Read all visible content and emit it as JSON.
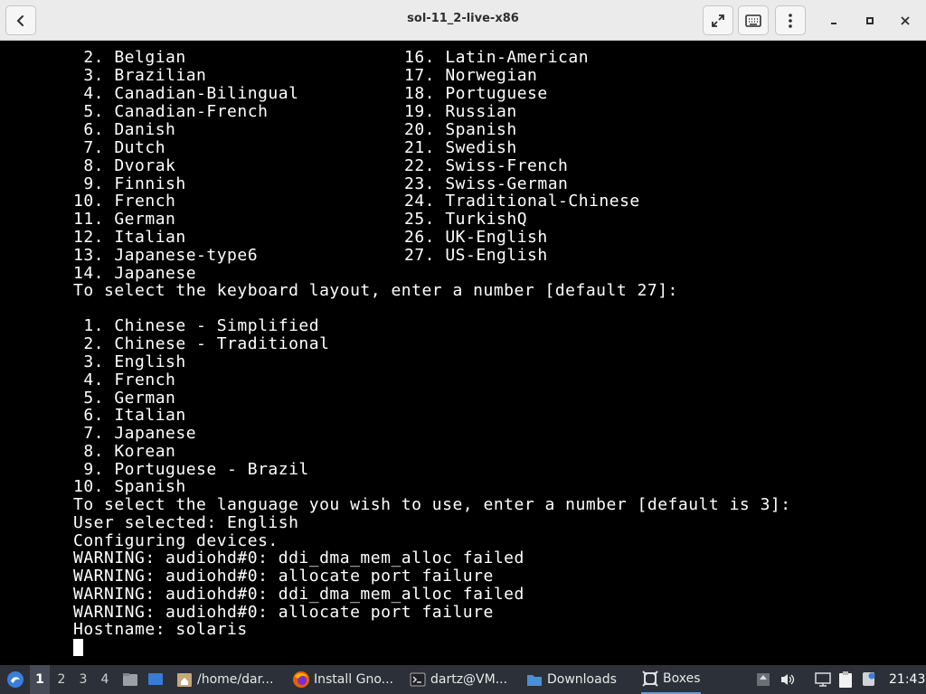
{
  "window": {
    "title": "sol-11_2-live-x86"
  },
  "console": {
    "lines": [
      " 2. Belgian",
      " 3. Brazilian",
      " 4. Canadian-Bilingual",
      " 5. Canadian-French",
      " 6. Danish",
      " 7. Dutch",
      " 8. Dvorak",
      " 9. Finnish",
      "10. French",
      "11. German",
      "12. Italian",
      "13. Japanese-type6",
      "14. Japanese"
    ],
    "lines_right": [
      "16. Latin-American",
      "17. Norwegian",
      "18. Portuguese",
      "19. Russian",
      "20. Spanish",
      "21. Swedish",
      "22. Swiss-French",
      "23. Swiss-German",
      "24. Traditional-Chinese",
      "25. TurkishQ",
      "26. UK-English",
      "27. US-English"
    ],
    "keyboard_prompt": "To select the keyboard layout, enter a number [default 27]:",
    "languages": [
      " 1. Chinese - Simplified",
      " 2. Chinese - Traditional",
      " 3. English",
      " 4. French",
      " 5. German",
      " 6. Italian",
      " 7. Japanese",
      " 8. Korean",
      " 9. Portuguese - Brazil",
      "10. Spanish"
    ],
    "tail": [
      "To select the language you wish to use, enter a number [default is 3]:",
      "User selected: English",
      "Configuring devices.",
      "WARNING: audiohd#0: ddi_dma_mem_alloc failed",
      "WARNING: audiohd#0: allocate port failure",
      "WARNING: audiohd#0: ddi_dma_mem_alloc failed",
      "WARNING: audiohd#0: allocate port failure",
      "Hostname: solaris"
    ]
  },
  "taskbar": {
    "workspaces": [
      "1",
      "2",
      "3",
      "4"
    ],
    "active_workspace": "1",
    "tasks": [
      {
        "label": "/home/dar...",
        "icon": "folder-home-icon"
      },
      {
        "label": "Install Gno...",
        "icon": "firefox-icon"
      },
      {
        "label": "dartz@VM...",
        "icon": "terminal-icon"
      },
      {
        "label": "Downloads",
        "icon": "folder-icon"
      },
      {
        "label": "Boxes",
        "icon": "boxes-icon"
      }
    ],
    "clock": "21:43"
  },
  "colors": {
    "console_bg": "#000000",
    "console_fg": "#ffffff",
    "titlebar_bg": "#ebebeb",
    "taskbar_bg": "#2c3038"
  }
}
